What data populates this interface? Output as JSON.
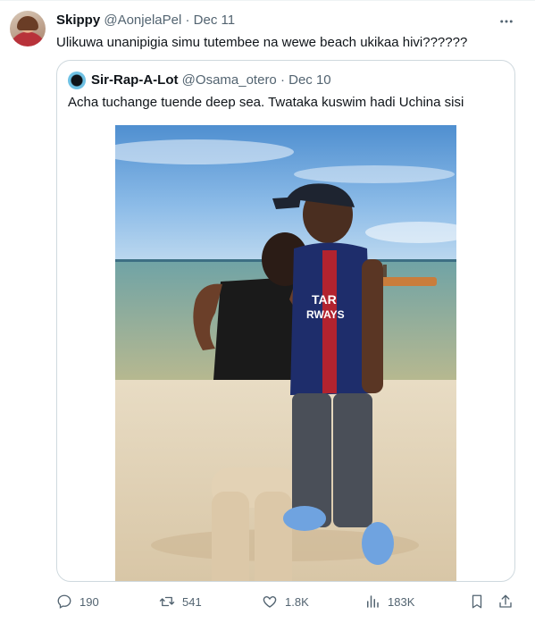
{
  "tweet": {
    "author_name": "Skippy",
    "author_handle": "@AonjelaPel",
    "separator": "·",
    "date": "Dec 11",
    "text": "Ulikuwa unanipigia simu tutembee na wewe beach ukikaa hivi??????",
    "more_icon": "more-horizontal-icon"
  },
  "quoted": {
    "author_name": "Sir-Rap-A-Lot",
    "author_handle": "@Osama_otero",
    "separator": "·",
    "date": "Dec 10",
    "text": "Acha tuchange tuende deep sea. Twataka kuswim hadi Uchina sisi",
    "image": {
      "shirt_text_line1": "TAR",
      "shirt_text_line2": "RWAYS"
    }
  },
  "actions": {
    "reply_count": "190",
    "retweet_count": "541",
    "like_count": "1.8K",
    "views_count": "183K",
    "icons": [
      "reply-icon",
      "retweet-icon",
      "like-icon",
      "views-icon",
      "bookmark-icon",
      "share-icon"
    ]
  },
  "colors": {
    "text": "#0f1419",
    "muted": "#536471",
    "border": "#cfd9de"
  }
}
